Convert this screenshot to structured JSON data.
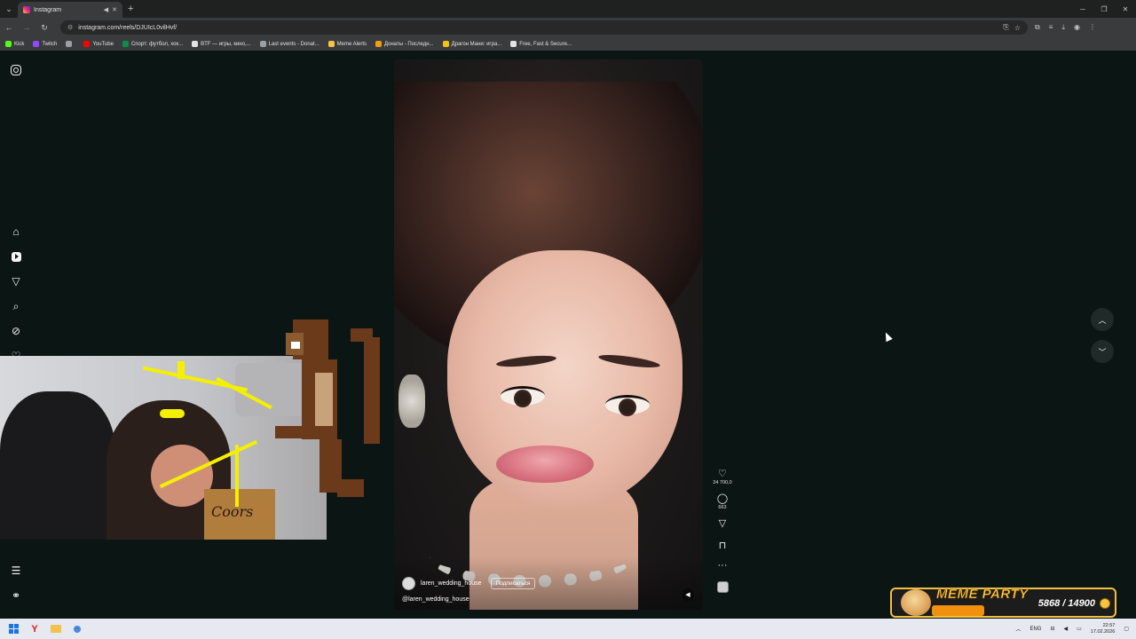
{
  "browser": {
    "tab_title": "Instagram",
    "url": "instagram.com/reels/DJUIcL0vilHvf/",
    "bookmarks": [
      {
        "label": "Kick",
        "color": "#53fc18"
      },
      {
        "label": "Twitch",
        "color": "#9146ff"
      },
      {
        "label": "",
        "color": "#9aa0a6"
      },
      {
        "label": "YouTube",
        "color": "#ff0000"
      },
      {
        "label": "Спорт: футбол, хок...",
        "color": "#0b8f48"
      },
      {
        "label": "BTF — игры, кино,...",
        "color": "#e3e3e3"
      },
      {
        "label": "Last events - Donat...",
        "color": "#9aa0a6"
      },
      {
        "label": "Meme Alerts",
        "color": "#f5c542"
      },
      {
        "label": "Донаты - Последн...",
        "color": "#f39c12"
      },
      {
        "label": "Драгон Мани: игра...",
        "color": "#f1c40f"
      },
      {
        "label": "Free, Fast & Secure...",
        "color": "#e3e3e3"
      }
    ]
  },
  "sidebar": {
    "icons": [
      "instagram-logo-icon",
      "home-icon",
      "reels-icon",
      "direct-send-icon",
      "search-icon",
      "explore-icon",
      "heart-icon",
      "menu-icon",
      "threads-icon"
    ]
  },
  "reel": {
    "username": "laren_wedding_house",
    "follow_label": "Подписаться",
    "caption": "@laren_wedding_house",
    "likes": "34 700,0",
    "comments": "663"
  },
  "overlay": {
    "box_text": "Coors",
    "meme_title": "MEME PARTY",
    "meme_count": "5868 / 14900",
    "meme_progress": 0.39
  },
  "taskbar": {
    "lang": "ENG",
    "time": "22:57",
    "date": "17.02.2026"
  }
}
